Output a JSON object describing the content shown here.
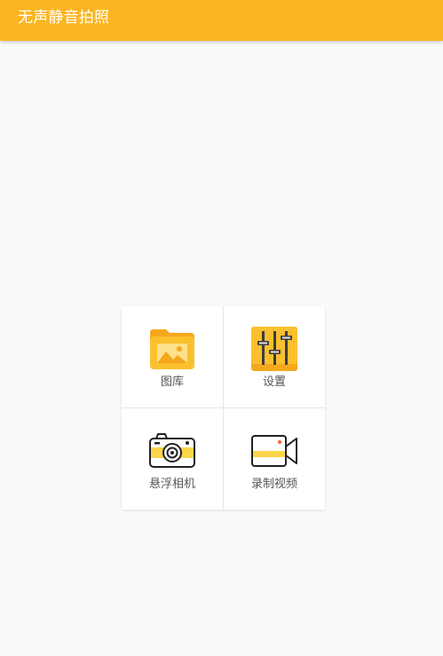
{
  "app_bar": {
    "title": "无声静音拍照",
    "color": "#fcb521"
  },
  "grid": {
    "items": [
      {
        "label": "图库",
        "icon": "gallery-folder-icon"
      },
      {
        "label": "设置",
        "icon": "settings-sliders-icon"
      },
      {
        "label": "悬浮相机",
        "icon": "floating-camera-icon"
      },
      {
        "label": "录制视频",
        "icon": "video-camera-icon"
      }
    ]
  }
}
